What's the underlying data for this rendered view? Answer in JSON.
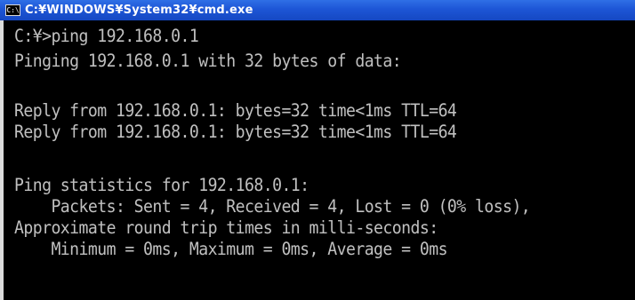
{
  "window": {
    "title": "C:¥WINDOWS¥System32¥cmd.exe",
    "icon_label": "C:\\"
  },
  "console": {
    "lines": [
      "C:¥>ping 192.168.0.1",
      "Pinging 192.168.0.1 with 32 bytes of data:",
      "",
      "Reply from 192.168.0.1: bytes=32 time<1ms TTL=64",
      "Reply from 192.168.0.1: bytes=32 time<1ms TTL=64",
      "",
      "Ping statistics for 192.168.0.1:",
      "    Packets: Sent = 4, Received = 4, Lost = 0 (0% loss),",
      "Approximate round trip times in milli-seconds:",
      "    Minimum = 0ms, Maximum = 0ms, Average = 0ms"
    ]
  },
  "colors": {
    "titlebar": "#1d55d6",
    "console_background": "#000000",
    "console_text": "#c0c0c0"
  }
}
